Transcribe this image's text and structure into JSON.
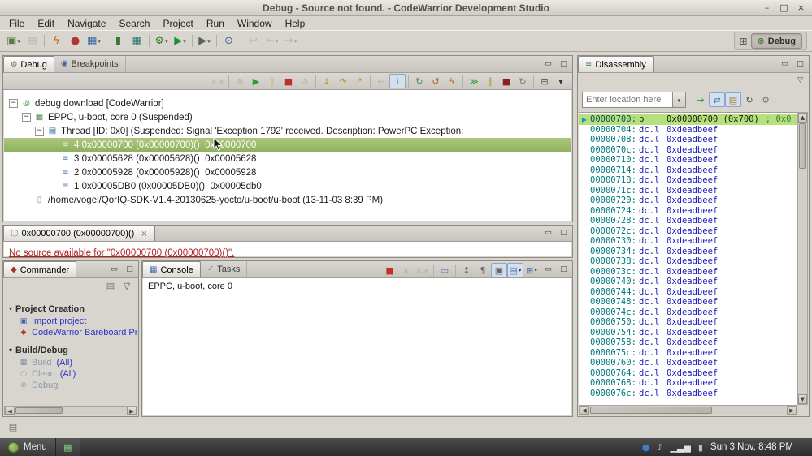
{
  "window": {
    "title": "Debug - Source not found. - CodeWarrior Development Studio",
    "controls": {
      "minimize": "–",
      "maximize": "□",
      "close": "×"
    }
  },
  "menubar": {
    "items": [
      "File",
      "Edit",
      "Navigate",
      "Search",
      "Project",
      "Run",
      "Window",
      "Help"
    ]
  },
  "icons": {
    "dropdown": "▾",
    "view_menu": "▽",
    "panel_minimize": "▭",
    "panel_maximize": "□",
    "expander_open": "−",
    "close_tab": "×",
    "combo_arrow": "▾",
    "scroll_up": "▲",
    "scroll_down": "▼",
    "scroll_left": "◀",
    "scroll_right": "▶",
    "current_ip_arrow": "▶",
    "section_triangle": "▾",
    "status_icon": "▤",
    "open_perspective": "⊞"
  },
  "perspective_bar": {
    "debug_label": "Debug",
    "debug_icon_glyph": "⊚",
    "debug_icon_color": "#4c7a2c"
  },
  "theme": {
    "link_blue": "#2b35c7",
    "error_red": "#b22222",
    "selection_green": "#8fb25d",
    "chrome": "#d8d4ce"
  },
  "toolbars": {
    "main": [
      {
        "name": "new-button",
        "glyph": "▣",
        "color": "#5a7a3a",
        "dd": true
      },
      {
        "name": "save-button",
        "glyph": "▤",
        "color": "#8a8a8a",
        "disabled": true
      },
      {
        "sep": true
      },
      {
        "name": "flash-programmer-button",
        "glyph": "ϟ",
        "color": "#c2651a"
      },
      {
        "name": "target-tasks-button",
        "glyph": "●",
        "color": "#b23430"
      },
      {
        "name": "cw-tools-button",
        "glyph": "▦",
        "color": "#3a66a8",
        "dd": true
      },
      {
        "sep": true
      },
      {
        "name": "build-button",
        "glyph": "▮",
        "color": "#2f7a2f"
      },
      {
        "name": "new-connection-button",
        "glyph": "▦",
        "color": "#2f7a7a"
      },
      {
        "sep": true
      },
      {
        "name": "debug-button",
        "glyph": "⚙",
        "color": "#3c7a28",
        "dd": true
      },
      {
        "name": "run-button",
        "glyph": "▶",
        "color": "#1c9230",
        "dd": true
      },
      {
        "sep": true
      },
      {
        "name": "external-tools-button",
        "glyph": "▶",
        "color": "#556655",
        "dd": true
      },
      {
        "sep": true
      },
      {
        "name": "search-button",
        "glyph": "⊙",
        "color": "#4a63a0"
      },
      {
        "sep": true
      },
      {
        "name": "last-edit-location-button",
        "glyph": "↩",
        "color": "#888888",
        "disabled": true
      },
      {
        "name": "back-button",
        "glyph": "←",
        "color": "#888888",
        "dd": true,
        "disabled": true
      },
      {
        "name": "forward-button",
        "glyph": "→",
        "color": "#888888",
        "dd": true,
        "disabled": true
      }
    ],
    "debug_view": [
      {
        "name": "remove-all-terminated-button",
        "glyph": "××",
        "color": "#888888",
        "disabled": true
      },
      {
        "sep": true
      },
      {
        "name": "connect-button",
        "glyph": "⊕",
        "color": "#888888",
        "disabled": true
      },
      {
        "name": "resume-button",
        "glyph": "▶",
        "color": "#2f9a2f"
      },
      {
        "name": "suspend-button",
        "glyph": "∥",
        "color": "#cc8a20",
        "disabled": true
      },
      {
        "name": "terminate-button",
        "glyph": "■",
        "color": "#c03028"
      },
      {
        "name": "disconnect-button",
        "glyph": "⊘",
        "color": "#888888",
        "disabled": true
      },
      {
        "sep": true
      },
      {
        "name": "step-into-button",
        "glyph": "↓",
        "color": "#b8951c"
      },
      {
        "name": "step-over-button",
        "glyph": "↷",
        "color": "#b8951c"
      },
      {
        "name": "step-return-button",
        "glyph": "↱",
        "color": "#b8951c"
      },
      {
        "sep": true
      },
      {
        "name": "drop-to-frame-button",
        "glyph": "↩",
        "color": "#888888",
        "disabled": true
      },
      {
        "name": "instruction-stepping-toggle",
        "glyph": "i",
        "color": "#3a66a8",
        "pressed": true
      },
      {
        "sep": true
      },
      {
        "name": "refresh-debug-button",
        "glyph": "↻",
        "color": "#3a8a5a"
      },
      {
        "name": "reset-target-button",
        "glyph": "↺",
        "color": "#b05818"
      },
      {
        "name": "flash-program-button",
        "glyph": "ϟ",
        "color": "#c2651a"
      },
      {
        "sep": true
      },
      {
        "name": "multicore-resume-button",
        "glyph": "≫",
        "color": "#2f9a2f"
      },
      {
        "name": "multicore-suspend-button",
        "glyph": "∥",
        "color": "#cc8a20"
      },
      {
        "name": "multicore-terminate-button",
        "glyph": "■",
        "color": "#8a2020"
      },
      {
        "name": "multicore-restart-button",
        "glyph": "↻",
        "color": "#777777"
      },
      {
        "sep": true
      },
      {
        "name": "collapse-all-button",
        "glyph": "⊟",
        "color": "#555555"
      },
      {
        "name": "view-menu-button",
        "glyph": "▾",
        "color": "#333333"
      }
    ],
    "console": [
      {
        "name": "terminate-console-button",
        "glyph": "■",
        "color": "#c03028"
      },
      {
        "name": "remove-launch-button",
        "glyph": "×",
        "color": "#888888",
        "disabled": true
      },
      {
        "name": "remove-all-launches-button",
        "glyph": "××",
        "color": "#888888",
        "disabled": true
      },
      {
        "sep": true
      },
      {
        "name": "clear-console-button",
        "glyph": "▭",
        "color": "#5a7ab0"
      },
      {
        "sep": true
      },
      {
        "name": "scroll-lock-toggle",
        "glyph": "↕",
        "color": "#666666"
      },
      {
        "name": "word-wrap-toggle",
        "glyph": "¶",
        "color": "#666666"
      },
      {
        "name": "pin-console-toggle",
        "glyph": "▣",
        "color": "#666666",
        "pressed": true
      },
      {
        "name": "display-console-button",
        "glyph": "▤",
        "color": "#5a7ab0",
        "dd": true,
        "pressed": true
      },
      {
        "name": "open-console-button",
        "glyph": "⊞",
        "color": "#5a7ab0",
        "dd": true
      }
    ],
    "disassembly": [
      {
        "name": "goto-pc-button",
        "glyph": "→",
        "color": "#2f9a2f"
      },
      {
        "name": "sync-context-toggle",
        "glyph": "⇄",
        "color": "#3a66a8",
        "pressed": true
      },
      {
        "name": "show-source-toggle",
        "glyph": "▤",
        "color": "#b07a28",
        "pressed": true
      },
      {
        "name": "refresh-button",
        "glyph": "↻",
        "color": "#555555"
      },
      {
        "name": "settings-button",
        "glyph": "⚙",
        "color": "#777777"
      }
    ],
    "commander": [
      {
        "name": "export-commander-button",
        "glyph": "▤",
        "color": "#777777"
      },
      {
        "name": "commander-menu-button",
        "glyph": "▽",
        "color": "#555555"
      }
    ]
  },
  "debug_view": {
    "tabs": [
      {
        "label": "Debug",
        "icon_glyph": "⊚",
        "icon_color": "#4c7a2c"
      },
      {
        "label": "Breakpoints",
        "icon_glyph": "◉",
        "icon_color": "#3a66a8"
      }
    ],
    "tree": [
      {
        "level": 0,
        "expander": true,
        "icon": "debug-target",
        "glyph": "◎",
        "color": "#3a8a3a",
        "label": "debug download [CodeWarrior]"
      },
      {
        "level": 1,
        "expander": true,
        "icon": "debug-core",
        "glyph": "▦",
        "color": "#4c8a4c",
        "label": "EPPC, u-boot, core 0 (Suspended)"
      },
      {
        "level": 2,
        "expander": true,
        "icon": "thread",
        "glyph": "▤",
        "color": "#3a66a8",
        "label": "Thread [ID: 0x0] (Suspended: Signal 'Exception 1792' received. Description: PowerPC Exception:"
      },
      {
        "level": 3,
        "selected": true,
        "icon": "stack-frame",
        "glyph": "≡",
        "color": "#eef4e0",
        "label": "4 0x00000700 (0x00000700)()  0x00000700"
      },
      {
        "level": 3,
        "icon": "stack-frame",
        "glyph": "≡",
        "color": "#4a7ab0",
        "label": "3 0x00005628 (0x00005628)()  0x00005628"
      },
      {
        "level": 3,
        "icon": "stack-frame",
        "glyph": "≡",
        "color": "#4a7ab0",
        "label": "2 0x00005928 (0x00005928)()  0x00005928"
      },
      {
        "level": 3,
        "icon": "stack-frame",
        "glyph": "≡",
        "color": "#4a7ab0",
        "label": "1 0x00005DB0 (0x00005DB0)()  0x00005db0"
      },
      {
        "level": 1,
        "icon": "binary-file",
        "glyph": "▯",
        "color": "#8a8a8a",
        "label": "/home/vogel/QorIQ-SDK-V1.4-20130625-yocto/u-boot/u-boot (13-11-03 8:39 PM)"
      }
    ]
  },
  "editor": {
    "tab": {
      "label": "0x00000700 (0x00000700)()",
      "icon_glyph": "▢",
      "icon_color": "#7a8aa0"
    },
    "message": "No source available for \"0x00000700 (0x00000700)()\"."
  },
  "commander": {
    "tab": {
      "label": "Commander",
      "icon_glyph": "◆",
      "icon_color": "#a03028"
    },
    "sections": [
      {
        "title": "Project Creation",
        "items": [
          {
            "name": "import-project",
            "label": "Import project",
            "glyph": "▣",
            "color": "#3a66a8"
          },
          {
            "name": "bareboard-project",
            "label": "CodeWarrior Bareboard Project",
            "glyph": "◆",
            "color": "#b03a28"
          }
        ]
      },
      {
        "title": "Build/Debug",
        "items": [
          {
            "name": "build-all",
            "label": "Build",
            "suffix": "(All)",
            "glyph": "▦",
            "color": "#7a8aa8",
            "muted": true
          },
          {
            "name": "clean-all",
            "label": "Clean",
            "suffix": "(All)",
            "glyph": "○",
            "color": "#8a98a8",
            "muted": true
          },
          {
            "name": "debug",
            "label": "Debug",
            "glyph": "⊚",
            "color": "#9a9a9a",
            "muted": true
          }
        ]
      }
    ]
  },
  "console": {
    "tabs": [
      {
        "label": "Console",
        "icon_glyph": "▦",
        "icon_color": "#3a66a8"
      },
      {
        "label": "Tasks",
        "icon_glyph": "✓",
        "icon_color": "#6a7a8a"
      }
    ],
    "first_line": "EPPC, u-boot, core 0"
  },
  "disassembly": {
    "tab": {
      "label": "Disassembly",
      "icon_glyph": "≡",
      "icon_color": "#3a7a7a"
    },
    "location_input": {
      "placeholder": "Enter location here"
    },
    "colors": {
      "address": "#00787d",
      "address_current": "#045055",
      "instruction": "#1a1ab8",
      "instruction_current": "#101a08",
      "comment": "#3a7a3a",
      "current_bg": "#b6e07e",
      "ip_arrow": "#1f93b8"
    },
    "rows": [
      {
        "address": "00000700:",
        "op": "b",
        "operand": "0x00000700 (0x700)",
        "comment": "; 0x0",
        "current": true
      },
      {
        "address": "00000704:",
        "op": "dc.l",
        "operand": "0xdeadbeef"
      },
      {
        "address": "00000708:",
        "op": "dc.l",
        "operand": "0xdeadbeef"
      },
      {
        "address": "0000070c:",
        "op": "dc.l",
        "operand": "0xdeadbeef"
      },
      {
        "address": "00000710:",
        "op": "dc.l",
        "operand": "0xdeadbeef"
      },
      {
        "address": "00000714:",
        "op": "dc.l",
        "operand": "0xdeadbeef"
      },
      {
        "address": "00000718:",
        "op": "dc.l",
        "operand": "0xdeadbeef"
      },
      {
        "address": "0000071c:",
        "op": "dc.l",
        "operand": "0xdeadbeef"
      },
      {
        "address": "00000720:",
        "op": "dc.l",
        "operand": "0xdeadbeef"
      },
      {
        "address": "00000724:",
        "op": "dc.l",
        "operand": "0xdeadbeef"
      },
      {
        "address": "00000728:",
        "op": "dc.l",
        "operand": "0xdeadbeef"
      },
      {
        "address": "0000072c:",
        "op": "dc.l",
        "operand": "0xdeadbeef"
      },
      {
        "address": "00000730:",
        "op": "dc.l",
        "operand": "0xdeadbeef"
      },
      {
        "address": "00000734:",
        "op": "dc.l",
        "operand": "0xdeadbeef"
      },
      {
        "address": "00000738:",
        "op": "dc.l",
        "operand": "0xdeadbeef"
      },
      {
        "address": "0000073c:",
        "op": "dc.l",
        "operand": "0xdeadbeef"
      },
      {
        "address": "00000740:",
        "op": "dc.l",
        "operand": "0xdeadbeef"
      },
      {
        "address": "00000744:",
        "op": "dc.l",
        "operand": "0xdeadbeef"
      },
      {
        "address": "00000748:",
        "op": "dc.l",
        "operand": "0xdeadbeef"
      },
      {
        "address": "0000074c:",
        "op": "dc.l",
        "operand": "0xdeadbeef"
      },
      {
        "address": "00000750:",
        "op": "dc.l",
        "operand": "0xdeadbeef"
      },
      {
        "address": "00000754:",
        "op": "dc.l",
        "operand": "0xdeadbeef"
      },
      {
        "address": "00000758:",
        "op": "dc.l",
        "operand": "0xdeadbeef"
      },
      {
        "address": "0000075c:",
        "op": "dc.l",
        "operand": "0xdeadbeef"
      },
      {
        "address": "00000760:",
        "op": "dc.l",
        "operand": "0xdeadbeef"
      },
      {
        "address": "00000764:",
        "op": "dc.l",
        "operand": "0xdeadbeef"
      },
      {
        "address": "00000768:",
        "op": "dc.l",
        "operand": "0xdeadbeef"
      },
      {
        "address": "0000076c:",
        "op": "dc.l",
        "operand": "0xdeadbeef"
      }
    ]
  },
  "taskbar": {
    "menu_label": "Menu",
    "clock": "Sun 3 Nov, 8:48 PM",
    "tray": [
      {
        "name": "update-manager-icon",
        "glyph": "●",
        "color": "#3a7fd4"
      },
      {
        "name": "volume-icon",
        "glyph": "♪",
        "color": "#e0e0e0"
      },
      {
        "name": "network-icon",
        "glyph": "▁▃▅",
        "color": "#e0e0e0"
      },
      {
        "name": "power-icon",
        "glyph": "▮",
        "color": "#bfbfbf"
      }
    ]
  }
}
